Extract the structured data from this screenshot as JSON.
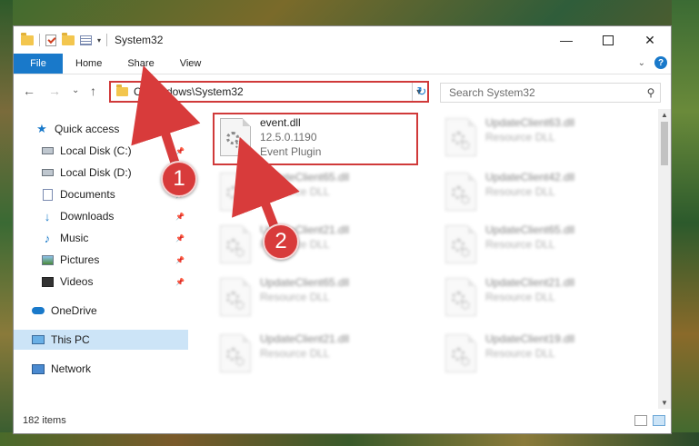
{
  "window": {
    "title": "System32",
    "controls": {
      "minimize": "—",
      "maximize": "",
      "close": "✕"
    }
  },
  "ribbon": {
    "tabs": [
      "File",
      "Home",
      "Share",
      "View"
    ],
    "help": "?",
    "expand": "⌄"
  },
  "navigation": {
    "back": "←",
    "forward": "→",
    "recent": "⌄",
    "up": "↑",
    "address": "C:\\Windows\\System32",
    "refresh": "↻",
    "search_placeholder": "Search System32"
  },
  "sidebar": {
    "items": [
      {
        "label": "Quick access",
        "icon": "star-icon",
        "pinned": false
      },
      {
        "label": "Local Disk (C:)",
        "icon": "drive-icon",
        "pinned": true
      },
      {
        "label": "Local Disk (D:)",
        "icon": "drive-icon",
        "pinned": false
      },
      {
        "label": "Documents",
        "icon": "document-icon",
        "pinned": true
      },
      {
        "label": "Downloads",
        "icon": "download-icon",
        "pinned": true
      },
      {
        "label": "Music",
        "icon": "music-icon",
        "pinned": true
      },
      {
        "label": "Pictures",
        "icon": "pictures-icon",
        "pinned": true
      },
      {
        "label": "Videos",
        "icon": "videos-icon",
        "pinned": true
      },
      {
        "label": "OneDrive",
        "icon": "onedrive-icon",
        "pinned": false
      },
      {
        "label": "This PC",
        "icon": "this-pc-icon",
        "pinned": false,
        "selected": true
      },
      {
        "label": "Network",
        "icon": "network-icon",
        "pinned": false
      }
    ]
  },
  "files": [
    {
      "name": "event.dll",
      "version": "12.5.0.1190",
      "description": "Event Plugin",
      "highlighted": true
    },
    {
      "name": "UpdateClient63.dll",
      "description": "Resource DLL",
      "blurred": true
    },
    {
      "name": "UpdateClient65.dll",
      "description": "Resource DLL",
      "blurred": true
    },
    {
      "name": "UpdateClient42.dll",
      "description": "Resource DLL",
      "blurred": true
    },
    {
      "name": "UpdateClient21.dll",
      "description": "Resource DLL",
      "blurred": true
    },
    {
      "name": "UpdateClient65.dll",
      "description": "Resource DLL",
      "blurred": true
    },
    {
      "name": "UpdateClient65.dll",
      "description": "Resource DLL",
      "blurred": true
    },
    {
      "name": "UpdateClient21.dll",
      "description": "Resource DLL",
      "blurred": true
    },
    {
      "name": "UpdateClient21.dll",
      "description": "Resource DLL",
      "blurred": true
    },
    {
      "name": "UpdateClient19.dll",
      "description": "Resource DLL",
      "blurred": true
    }
  ],
  "status": {
    "item_count": "182 items"
  },
  "annotations": {
    "step1": "1",
    "step2": "2"
  },
  "colors": {
    "accent": "#1979ca",
    "highlight": "#d03a3a",
    "selected": "#cce4f7"
  }
}
